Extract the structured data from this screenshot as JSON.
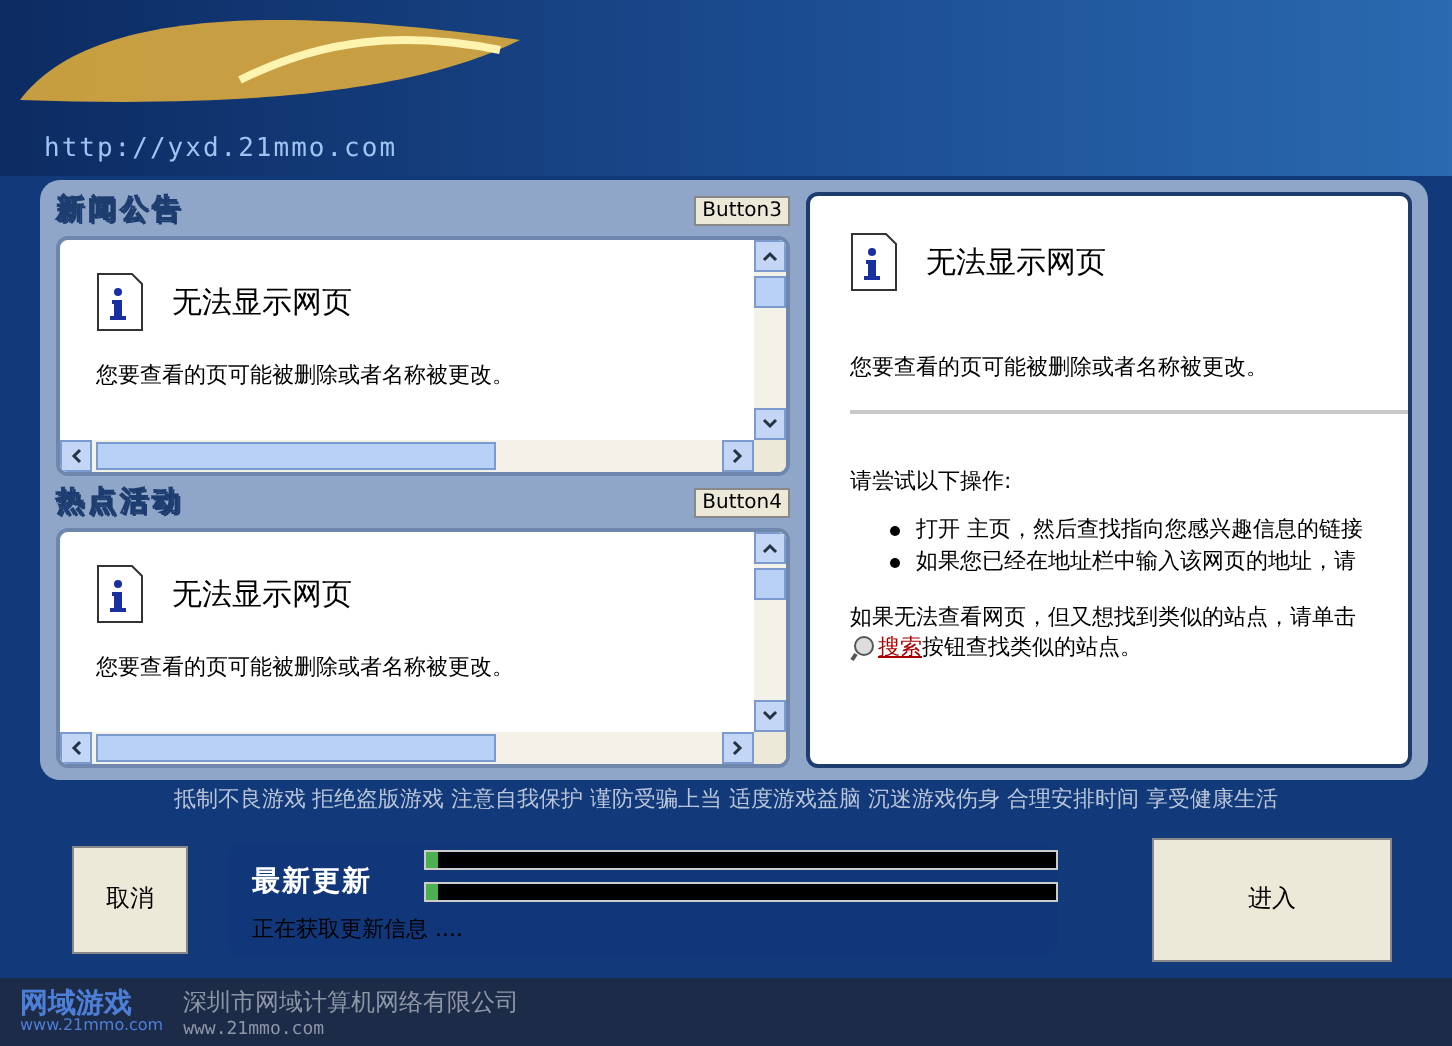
{
  "banner": {
    "url": "http://yxd.21mmo.com"
  },
  "panels": [
    {
      "title": "新闻公告",
      "button": "Button3",
      "page": {
        "heading": "无法显示网页",
        "message": "您要查看的页可能被删除或者名称被更改。"
      }
    },
    {
      "title": "热点活动",
      "button": "Button4",
      "page": {
        "heading": "无法显示网页",
        "message": "您要查看的页可能被删除或者名称被更改。"
      }
    }
  ],
  "main_page": {
    "heading": "无法显示网页",
    "message": "您要查看的页可能被删除或者名称被更改。",
    "prompt": "请尝试以下操作:",
    "bullets": [
      "打开 主页，然后查找指向您感兴趣信息的链接",
      "如果您已经在地址栏中输入该网页的地址，请"
    ],
    "search_before": "如果无法查看网页，但又想找到类似的站点，请单击",
    "search_link": "搜索",
    "search_after": "按钮查找类似的站点。"
  },
  "slogan": "抵制不良游戏 拒绝盗版游戏 注意自我保护 谨防受骗上当 适度游戏益脑 沉迷游戏伤身 合理安排时间 享受健康生活",
  "cancel_button": "取消",
  "update": {
    "title": "最新更新",
    "bars": [
      {
        "level": 0.02
      },
      {
        "level": 0.02
      }
    ],
    "status": "正在获取更新信息 ...."
  },
  "enter_button": "进入",
  "footer": {
    "logo": "网域游戏",
    "logo_url": "www.21mmo.com",
    "company": "深圳市网域计算机网络有限公司",
    "url": "www.21mmo.com"
  }
}
